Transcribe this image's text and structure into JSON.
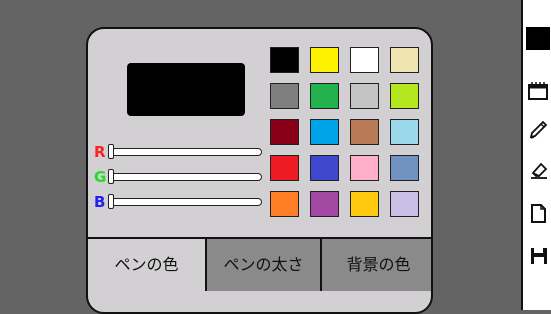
{
  "colors": {
    "canvas_bg": "#646464",
    "panel_bg": "#d3d0d3",
    "active_tab": "#d3d0d3",
    "inactive_tab": "#8a8a8a",
    "preview": "#000000",
    "current_color": "#000000"
  },
  "sliders": [
    {
      "label": "R",
      "color": "#ff2020",
      "value": 0
    },
    {
      "label": "G",
      "color": "#22dd22",
      "value": 0
    },
    {
      "label": "B",
      "color": "#2222ee",
      "value": 0
    }
  ],
  "swatches": [
    [
      "#000000",
      "#fff200",
      "#ffffff",
      "#efe4b0"
    ],
    [
      "#7f7f7f",
      "#22b14c",
      "#c3c3c3",
      "#b5e61d"
    ],
    [
      "#880015",
      "#00a2e8",
      "#b97a57",
      "#99d9ea"
    ],
    [
      "#ed1c24",
      "#3f48cc",
      "#ffaec9",
      "#7092be"
    ],
    [
      "#ff7f27",
      "#a349a4",
      "#ffc90e",
      "#c8bfe7"
    ]
  ],
  "tabs": {
    "pen_color": "ペンの色",
    "pen_width": "ペンの太さ",
    "bg_color": "背景の色",
    "active": "pen_color"
  },
  "toolbar": {
    "icons": [
      "current-color-swatch",
      "palette-icon",
      "pencil-icon",
      "eraser-icon",
      "new-file-icon",
      "save-icon"
    ]
  }
}
